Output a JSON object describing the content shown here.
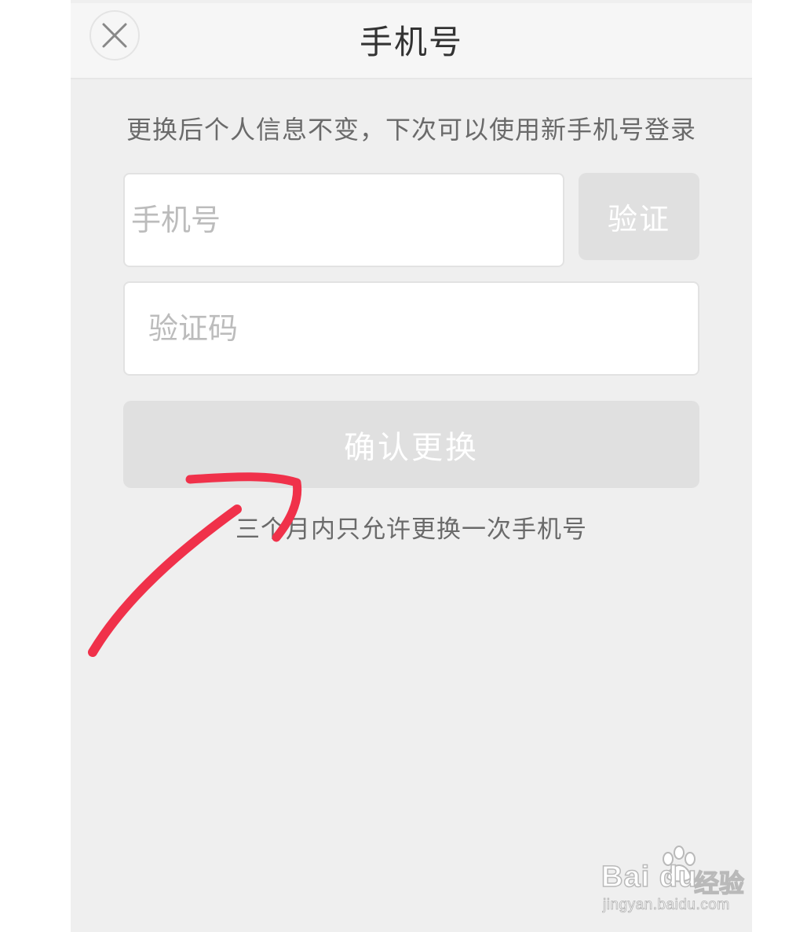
{
  "header": {
    "title": "手机号",
    "close_icon": "close-icon"
  },
  "form": {
    "notice": "更换后个人信息不变，下次可以使用新手机号登录",
    "phone_placeholder": "手机号",
    "verify_label": "验证",
    "code_placeholder": "验证码",
    "confirm_label": "确认更换",
    "limit_note": "三个月内只允许更换一次手机号"
  },
  "annotation": {
    "icon": "arrow-annotation-icon",
    "color": "#f0314a"
  },
  "watermark": {
    "brand": "Bai du",
    "brand_cn": "经验",
    "url": "jingyan.baidu.com",
    "icon": "baidu-paw-icon"
  },
  "colors": {
    "background": "#efefef",
    "header_background": "#f6f6f6",
    "disabled_button": "#e0e0e0",
    "field_background": "#ffffff"
  }
}
